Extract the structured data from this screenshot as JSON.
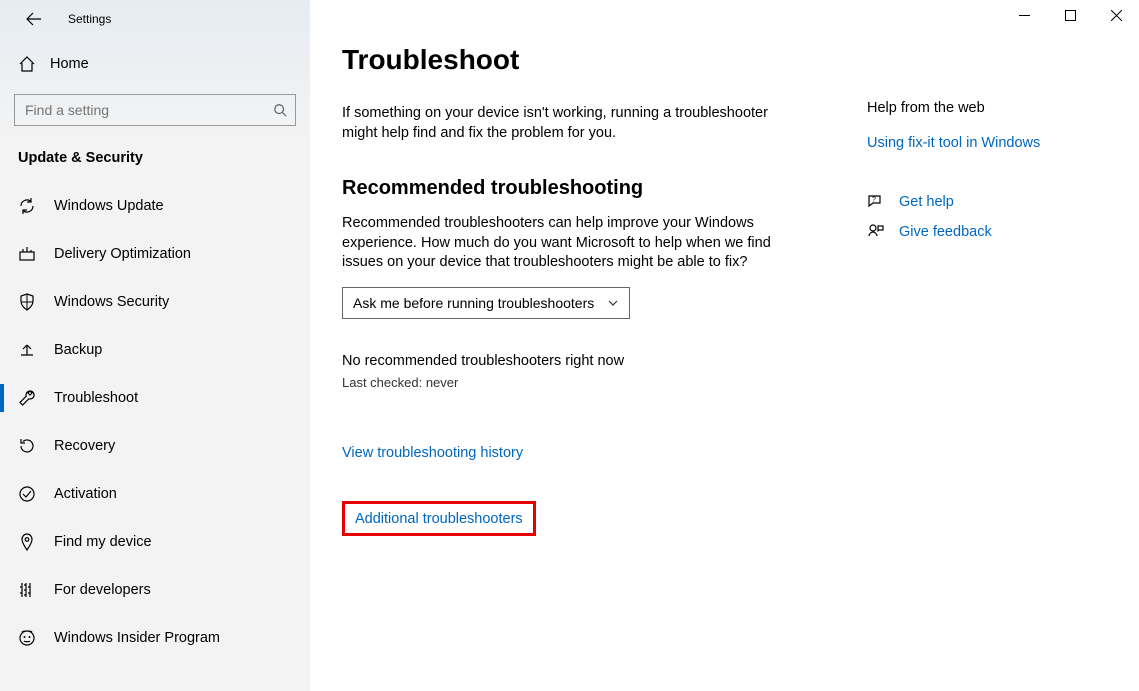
{
  "app": {
    "title": "Settings"
  },
  "sidebar": {
    "home_label": "Home",
    "search_placeholder": "Find a setting",
    "category": "Update & Security",
    "items": [
      {
        "label": "Windows Update"
      },
      {
        "label": "Delivery Optimization"
      },
      {
        "label": "Windows Security"
      },
      {
        "label": "Backup"
      },
      {
        "label": "Troubleshoot"
      },
      {
        "label": "Recovery"
      },
      {
        "label": "Activation"
      },
      {
        "label": "Find my device"
      },
      {
        "label": "For developers"
      },
      {
        "label": "Windows Insider Program"
      }
    ]
  },
  "main": {
    "heading": "Troubleshoot",
    "intro": "If something on your device isn't working, running a troubleshooter might help find and fix the problem for you.",
    "section_heading": "Recommended troubleshooting",
    "section_text": "Recommended troubleshooters can help improve your Windows experience. How much do you want Microsoft to help when we find issues on your device that troubleshooters might be able to fix?",
    "dropdown_value": "Ask me before running troubleshooters",
    "status": "No recommended troubleshooters right now",
    "status_sub": "Last checked: never",
    "history_link": "View troubleshooting history",
    "additional_link": "Additional troubleshooters"
  },
  "aside": {
    "help_heading": "Help from the web",
    "help_link": "Using fix-it tool in Windows",
    "get_help": "Get help",
    "give_feedback": "Give feedback"
  }
}
